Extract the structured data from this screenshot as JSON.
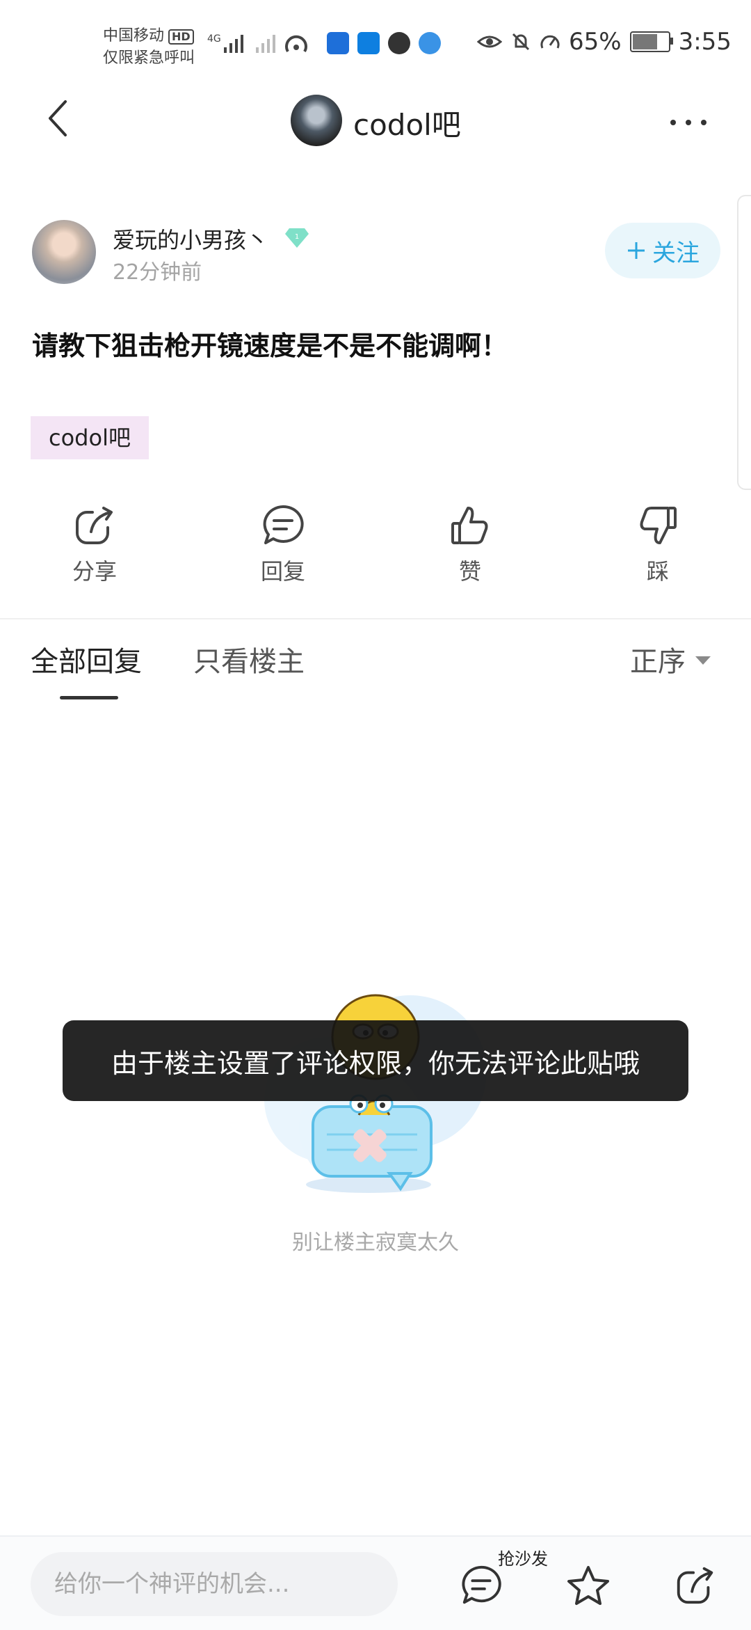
{
  "status_bar": {
    "carrier": "中国移动",
    "carrier_badge": "HD",
    "emergency": "仅限紧急呼叫",
    "network": "4G",
    "battery": "65%",
    "battery_level": 0.65,
    "time": "3:55"
  },
  "nav": {
    "title": "codol吧"
  },
  "post": {
    "username": "爱玩的小男孩丶",
    "level": "1",
    "time": "22分钟前",
    "follow_label": "关注",
    "title": "请教下狙击枪开镜速度是不是不能调啊！",
    "forum_tag": "codol吧"
  },
  "actions": {
    "share": "分享",
    "reply": "回复",
    "like": "赞",
    "dislike": "踩"
  },
  "tabs": {
    "all_replies": "全部回复",
    "owner_only": "只看楼主",
    "sort": "正序"
  },
  "empty_state": {
    "text": "别让楼主寂寞太久"
  },
  "toast": {
    "text": "由于楼主设置了评论权限，你无法评论此贴哦"
  },
  "bottom_bar": {
    "comment_placeholder": "给你一个神评的机会...",
    "sofa_label": "抢沙发"
  },
  "colors": {
    "accent": "#2aa6de",
    "tag_bg": "#f4e5f5",
    "level_badge": "#7fe0c8"
  }
}
